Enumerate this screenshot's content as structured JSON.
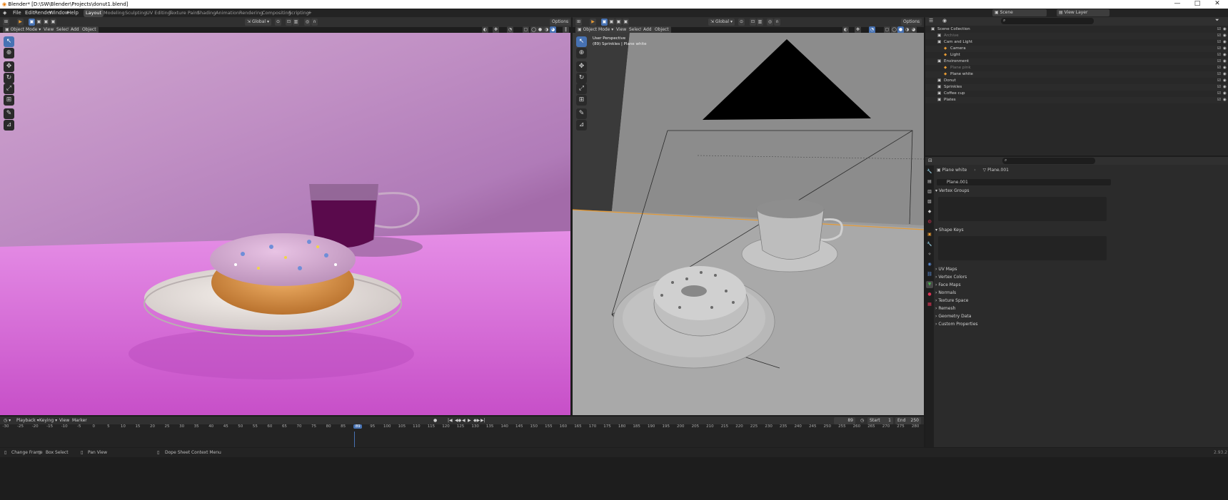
{
  "window": {
    "title": "Blender* [D:\\SW\\Blender\\Projects\\donut1.blend]",
    "minimize": "—",
    "maximize": "□",
    "close": "✕"
  },
  "menu": [
    "File",
    "Edit",
    "Render",
    "Window",
    "Help"
  ],
  "workspaces": [
    "Layout",
    "Modeling",
    "Sculpting",
    "UV Editing",
    "Texture Paint",
    "Shading",
    "Animation",
    "Rendering",
    "Compositing",
    "Scripting"
  ],
  "active_workspace": "Layout",
  "scene": {
    "label": "Scene",
    "view_layer": "View Layer"
  },
  "left_viewport": {
    "mode": "Object Mode",
    "menus": [
      "View",
      "Select",
      "Add",
      "Object"
    ],
    "orientation": "Global",
    "options": "Options"
  },
  "right_viewport": {
    "mode": "Object Mode",
    "menus": [
      "View",
      "Select",
      "Add",
      "Object"
    ],
    "orientation": "Global",
    "options": "Options",
    "overlay_title": "User Perspective",
    "overlay_sub": "(89) Sprinkles | Plane white"
  },
  "outliner": {
    "search_placeholder": "",
    "rows": [
      {
        "label": "Scene Collection",
        "indent": 0,
        "color": "#d0d0d0"
      },
      {
        "label": "Archive",
        "indent": 1,
        "color": "#7a7a7a"
      },
      {
        "label": "Cam and Light",
        "indent": 1,
        "color": "#d0d0d0"
      },
      {
        "label": "Camera",
        "indent": 2,
        "color": "#d0d0d0"
      },
      {
        "label": "Light",
        "indent": 2,
        "color": "#d0d0d0"
      },
      {
        "label": "Environment",
        "indent": 1,
        "color": "#d0d0d0"
      },
      {
        "label": "Plane pink",
        "indent": 2,
        "color": "#7a7a7a"
      },
      {
        "label": "Plane white",
        "indent": 2,
        "color": "#d0d0d0"
      },
      {
        "label": "Donut",
        "indent": 1,
        "color": "#d0d0d0"
      },
      {
        "label": "Sprinkles",
        "indent": 1,
        "color": "#d0d0d0"
      },
      {
        "label": "Coffee cup",
        "indent": 1,
        "color": "#d0d0d0"
      },
      {
        "label": "Plates",
        "indent": 1,
        "color": "#d0d0d0"
      }
    ]
  },
  "properties": {
    "object": "Plane white",
    "mesh": "Plane.001",
    "mesh_field": "Plane.001",
    "sections": [
      "Vertex Groups",
      "Shape Keys",
      "UV Maps",
      "Vertex Colors",
      "Face Maps",
      "Normals",
      "Texture Space",
      "Remesh",
      "Geometry Data",
      "Custom Properties"
    ]
  },
  "timeline": {
    "menus": [
      "Playback",
      "Keying",
      "View",
      "Marker"
    ],
    "current_frame": "89",
    "start_label": "Start",
    "start": "1",
    "end_label": "End",
    "end": "250",
    "ticks": [
      "-30",
      "-25",
      "-20",
      "-15",
      "-10",
      "-5",
      "0",
      "5",
      "10",
      "15",
      "20",
      "25",
      "30",
      "35",
      "40",
      "45",
      "50",
      "55",
      "60",
      "65",
      "70",
      "75",
      "80",
      "85",
      "89",
      "95",
      "100",
      "105",
      "110",
      "115",
      "120",
      "125",
      "130",
      "135",
      "140",
      "145",
      "150",
      "155",
      "160",
      "165",
      "170",
      "175",
      "180",
      "185",
      "190",
      "195",
      "200",
      "205",
      "210",
      "215",
      "220",
      "225",
      "230",
      "235",
      "240",
      "245",
      "250",
      "255",
      "260",
      "265",
      "270",
      "275",
      "280"
    ]
  },
  "status": {
    "left": "Change Frame",
    "box": "Box Select",
    "pan": "Pan View",
    "context": "Dope Sheet Context Menu",
    "version": "2.93.2"
  },
  "colors": {
    "accent": "#4772b3",
    "orange": "#e69a33",
    "active_frame": "#4772b3"
  }
}
